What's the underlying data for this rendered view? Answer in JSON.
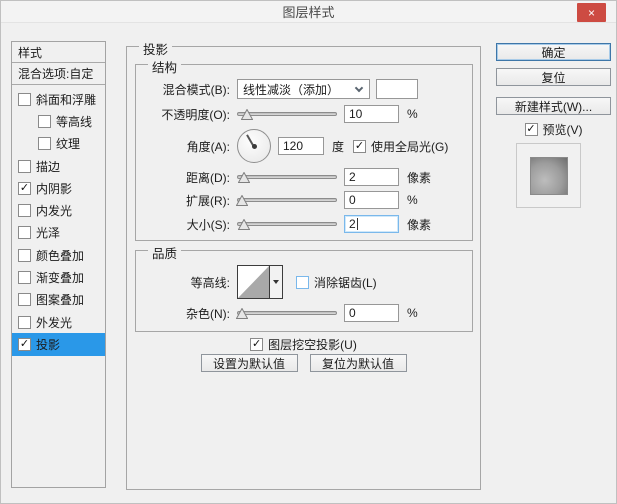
{
  "window": {
    "title": "图层样式",
    "close_icon": "×"
  },
  "sidebar": {
    "header": "样式",
    "blending_options": "混合选项:自定",
    "items": [
      {
        "label": "斜面和浮雕",
        "checked": false,
        "indent": false,
        "selected": false
      },
      {
        "label": "等高线",
        "checked": false,
        "indent": true,
        "selected": false
      },
      {
        "label": "纹理",
        "checked": false,
        "indent": true,
        "selected": false
      },
      {
        "label": "描边",
        "checked": false,
        "indent": false,
        "selected": false
      },
      {
        "label": "内阴影",
        "checked": true,
        "indent": false,
        "selected": false
      },
      {
        "label": "内发光",
        "checked": false,
        "indent": false,
        "selected": false
      },
      {
        "label": "光泽",
        "checked": false,
        "indent": false,
        "selected": false
      },
      {
        "label": "颜色叠加",
        "checked": false,
        "indent": false,
        "selected": false
      },
      {
        "label": "渐变叠加",
        "checked": false,
        "indent": false,
        "selected": false
      },
      {
        "label": "图案叠加",
        "checked": false,
        "indent": false,
        "selected": false
      },
      {
        "label": "外发光",
        "checked": false,
        "indent": false,
        "selected": false
      },
      {
        "label": "投影",
        "checked": true,
        "indent": false,
        "selected": true
      }
    ]
  },
  "panel": {
    "title": "投影",
    "structure": {
      "legend": "结构",
      "blend_mode": {
        "label": "混合模式(B):",
        "value": "线性减淡（添加）"
      },
      "opacity": {
        "label": "不透明度(O):",
        "value": "10",
        "unit": "%"
      },
      "angle": {
        "label": "角度(A):",
        "value": "120",
        "unit": "度",
        "global_light": {
          "label": "使用全局光(G)",
          "checked": true
        }
      },
      "distance": {
        "label": "距离(D):",
        "value": "2",
        "unit": "像素"
      },
      "spread": {
        "label": "扩展(R):",
        "value": "0",
        "unit": "%"
      },
      "size": {
        "label": "大小(S):",
        "value": "2",
        "unit": "像素"
      }
    },
    "quality": {
      "legend": "品质",
      "contour": {
        "label": "等高线:",
        "antialias": {
          "label": "消除锯齿(L)",
          "checked": false
        }
      },
      "noise": {
        "label": "杂色(N):",
        "value": "0",
        "unit": "%"
      }
    },
    "knockout": {
      "label": "图层挖空投影(U)",
      "checked": true
    },
    "buttons": {
      "set_default": "设置为默认值",
      "reset_default": "复位为默认值"
    }
  },
  "actions": {
    "ok": "确定",
    "reset": "复位",
    "new_style": "新建样式(W)...",
    "preview": {
      "label": "预览(V)",
      "checked": true
    }
  },
  "colors": {
    "selection": "#2a98e8",
    "close_button": "#cd4b42",
    "focus_border": "#7ab8eb",
    "dialog_bg": "#f0f0f0"
  }
}
